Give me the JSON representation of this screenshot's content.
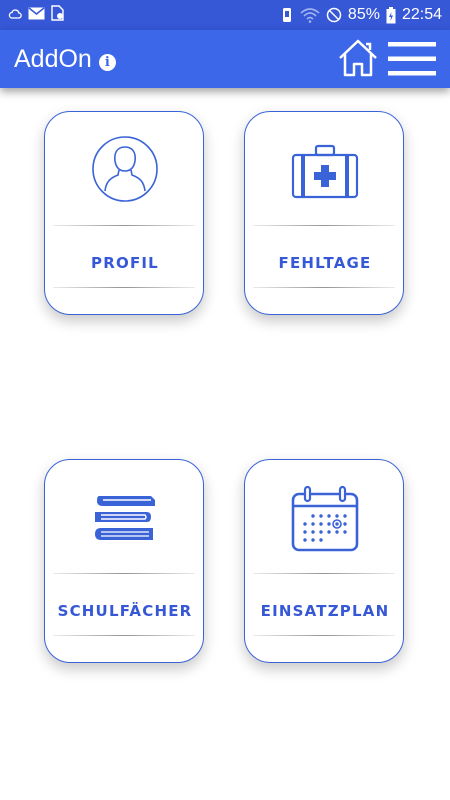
{
  "status_bar": {
    "battery": "85%",
    "time": "22:54"
  },
  "app_bar": {
    "title": "AddOn"
  },
  "tiles": [
    {
      "label": "PROFIL",
      "icon": "person-icon"
    },
    {
      "label": "FEHLTAGE",
      "icon": "first-aid-kit-icon"
    },
    {
      "label": "SCHULFÄCHER",
      "icon": "books-icon"
    },
    {
      "label": "EINSATZPLAN",
      "icon": "calendar-icon"
    }
  ],
  "colors": {
    "status_bar": "#3657d6",
    "app_bar": "#3c67e8",
    "accent": "#3a63d8"
  }
}
